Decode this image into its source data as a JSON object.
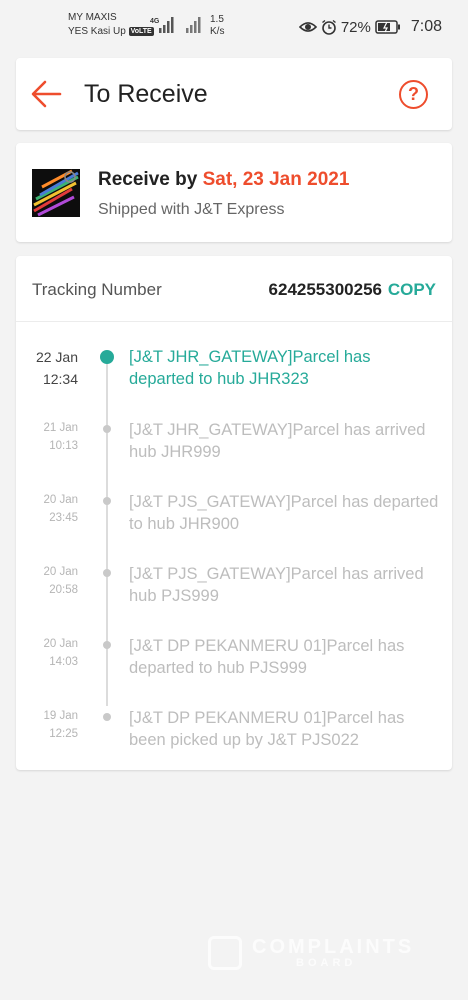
{
  "status_bar": {
    "carrier1": "MY MAXIS",
    "carrier2": "YES Kasi Up",
    "volte": "VoLTE",
    "net_type": "4G",
    "speed_value": "1.5",
    "speed_unit": "K/s",
    "battery": "72%",
    "time": "7:08"
  },
  "header": {
    "title": "To Receive",
    "back_icon": "back-arrow-icon",
    "help_icon": "help-icon",
    "help_label": "?",
    "accent": "#ee4d2d"
  },
  "delivery": {
    "receive_prefix": "Receive by",
    "receive_date": "Sat, 23 Jan 2021",
    "shipped_with": "Shipped with J&T Express"
  },
  "tracking": {
    "label": "Tracking Number",
    "number": "624255300256",
    "copy_label": "COPY",
    "active_color": "#26aa99",
    "events": [
      {
        "date": "22 Jan",
        "time": "12:34",
        "text": "[J&T JHR_GATEWAY]Parcel has departed to hub JHR323",
        "active": true
      },
      {
        "date": "21 Jan",
        "time": "10:13",
        "text": "[J&T JHR_GATEWAY]Parcel has arrived hub JHR999",
        "active": false
      },
      {
        "date": "20 Jan",
        "time": "23:45",
        "text": "[J&T PJS_GATEWAY]Parcel has departed to hub JHR900",
        "active": false
      },
      {
        "date": "20 Jan",
        "time": "20:58",
        "text": "[J&T PJS_GATEWAY]Parcel has arrived hub PJS999",
        "active": false
      },
      {
        "date": "20 Jan",
        "time": "14:03",
        "text": "[J&T DP PEKANMERU 01]Parcel has departed to hub PJS999",
        "active": false
      },
      {
        "date": "19 Jan",
        "time": "12:25",
        "text": "[J&T DP PEKANMERU 01]Parcel has been picked up by J&T PJS022",
        "active": false
      }
    ]
  },
  "watermark": {
    "line1": "COMPLAINTS",
    "line2": "BOARD"
  }
}
